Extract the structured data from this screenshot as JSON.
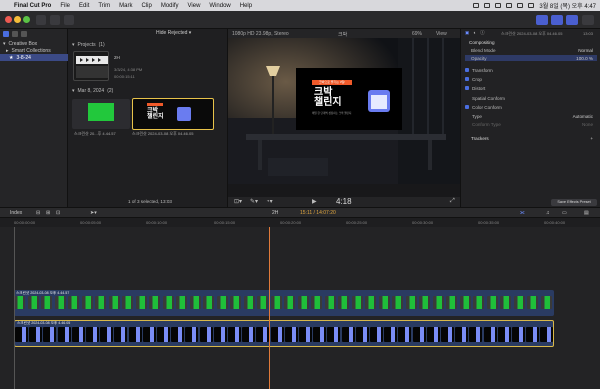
{
  "menubar": {
    "apple": "",
    "app_name": "Final Cut Pro",
    "items": [
      "File",
      "Edit",
      "Trim",
      "Mark",
      "Clip",
      "Modify",
      "View",
      "Window",
      "Help"
    ],
    "clock": "3월 8일 (목) 오후 4:47"
  },
  "toolbar": {
    "hide_rejected": "Hide Rejected",
    "format": "1080p HD 23.98p, Stereo",
    "clip_name": "크박",
    "zoom": "69%",
    "view": "View"
  },
  "sidebar": {
    "items": [
      {
        "label": "Creative Box",
        "selected": false
      },
      {
        "label": "Smart Collections",
        "selected": false
      },
      {
        "label": "3-8-24",
        "selected": true
      }
    ]
  },
  "browser": {
    "projects_label": "Projects",
    "projects_count": "(1)",
    "project_name": "2H",
    "project_date": "3/3/24, 4:38 PM",
    "project_duration": "00:00:15:11",
    "event_label": "Mar 8, 2024",
    "event_count": "(2)",
    "clip1_name": "스크린샷 20...후 4.44.57",
    "clip2_name": "스크린샷 2024-03-08 오후 04.46.05",
    "status": "1 of 3 selected, 13:03"
  },
  "viewer": {
    "badge": "크박으로 즐기는 3일!",
    "title_line1": "크박",
    "title_line2": "챌린지",
    "subtitle": "매일 한 단계씩 성장하는 크박 챌린지",
    "timecode": "4:18"
  },
  "inspector": {
    "header": "스크린샷 2024-03-08 오후 04.46.05",
    "duration": "13:03",
    "section": "Compositing",
    "blend_mode_label": "Blend Mode",
    "blend_mode_value": "Normal",
    "opacity_label": "Opacity",
    "opacity_value": "100.0 %",
    "transform": "Transform",
    "crop": "Crop",
    "distort": "Distort",
    "spatial": "Spatial Conform",
    "color_conform": "Color Conform",
    "type_label": "Type",
    "type_value": "Automatic",
    "conform_label": "Conform Type",
    "conform_value": "None",
    "trackers": "Trackers",
    "save_preset": "Save Effects Preset"
  },
  "timeline": {
    "index": "Index",
    "project": "2H",
    "duration": "15:11 / 14:07:20",
    "upper_clip": "스크린샷 2024-03-08 오후 4.44.57",
    "lower_clip": "스크린샷 2024-03-08 오후 4.46.05",
    "ruler": [
      "00:00:00:00",
      "00:00:05:00",
      "00:00:10:00",
      "00:00:15:00",
      "00:00:20:00",
      "00:00:25:00",
      "00:00:30:00",
      "00:00:35:00",
      "00:00:40:00"
    ]
  },
  "colors": {
    "accent": "#4a5fd0",
    "selection": "#3b4a86",
    "playhead": "#e07a3a",
    "clip_border": "#d8b84a"
  }
}
